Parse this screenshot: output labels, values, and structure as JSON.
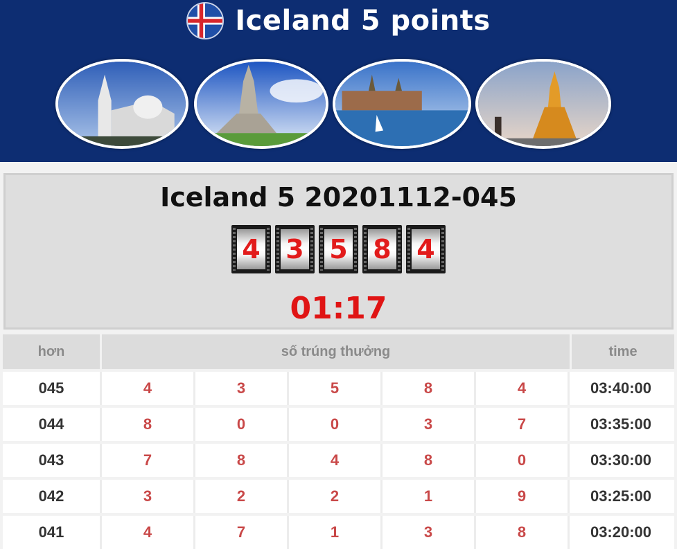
{
  "header": {
    "title": "Iceland 5 points",
    "flag_icon": "iceland-flag-icon",
    "photos": [
      "church-photo",
      "hallgrimskirkja-photo",
      "castle-harbor-photo",
      "golden-tower-photo"
    ]
  },
  "draw": {
    "title": "Iceland 5 20201112-045",
    "digits": [
      "4",
      "3",
      "5",
      "8",
      "4"
    ],
    "countdown": "01:17"
  },
  "table": {
    "headers": {
      "issue": "hơn",
      "numbers": "số trúng thưởng",
      "time": "time"
    },
    "rows": [
      {
        "issue": "045",
        "n": [
          "4",
          "3",
          "5",
          "8",
          "4"
        ],
        "time": "03:40:00"
      },
      {
        "issue": "044",
        "n": [
          "8",
          "0",
          "0",
          "3",
          "7"
        ],
        "time": "03:35:00"
      },
      {
        "issue": "043",
        "n": [
          "7",
          "8",
          "4",
          "8",
          "0"
        ],
        "time": "03:30:00"
      },
      {
        "issue": "042",
        "n": [
          "3",
          "2",
          "2",
          "1",
          "9"
        ],
        "time": "03:25:00"
      },
      {
        "issue": "041",
        "n": [
          "4",
          "7",
          "1",
          "3",
          "8"
        ],
        "time": "03:20:00"
      }
    ]
  },
  "colors": {
    "header_bg": "#0d2d72",
    "digit_red": "#e21b1b",
    "number_red": "#c94848"
  }
}
